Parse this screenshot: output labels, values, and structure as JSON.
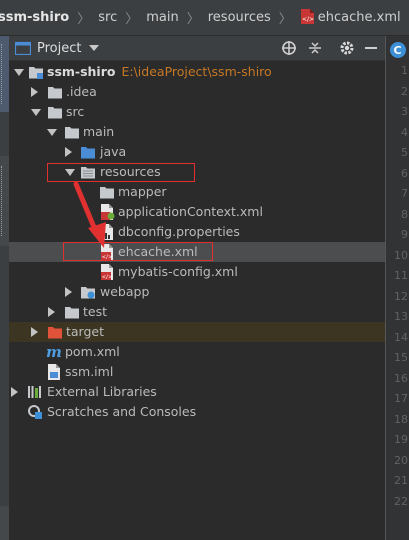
{
  "breadcrumb": {
    "items": [
      "ssm-shiro",
      "src",
      "main",
      "resources",
      "ehcache.xml"
    ],
    "separator": "〉"
  },
  "toolbar": {
    "title": "Project",
    "icons": [
      "target-icon",
      "collapse-all-icon",
      "gear-icon",
      "minimize-icon"
    ]
  },
  "tree": {
    "root_label": "ssm-shiro",
    "root_path": "E:\\ideaProject\\ssm-shiro",
    "idea": ".idea",
    "src": "src",
    "main": "main",
    "java": "java",
    "resources": "resources",
    "mapper": "mapper",
    "applicationContext": "applicationContext.xml",
    "dbconfig": "dbconfig.properties",
    "ehcache": "ehcache.xml",
    "mybatis": "mybatis-config.xml",
    "webapp": "webapp",
    "test": "test",
    "target": "target",
    "pom": "pom.xml",
    "iml": "ssm.iml",
    "external": "External Libraries",
    "scratches": "Scratches and Consoles"
  },
  "gutter": {
    "lines": [
      "1",
      "2",
      "3",
      "4",
      "5",
      "6",
      "7",
      "8",
      "9",
      "10",
      "11",
      "12",
      "13",
      "14",
      "15",
      "16",
      "17",
      "18",
      "19",
      "20",
      "21",
      "22"
    ]
  },
  "colors": {
    "selection": "#4b4d4f",
    "highlight_box": "#e03030",
    "arrow": "#e03030",
    "excluded_folder": "#3b3522",
    "path_text": "#c57825"
  }
}
